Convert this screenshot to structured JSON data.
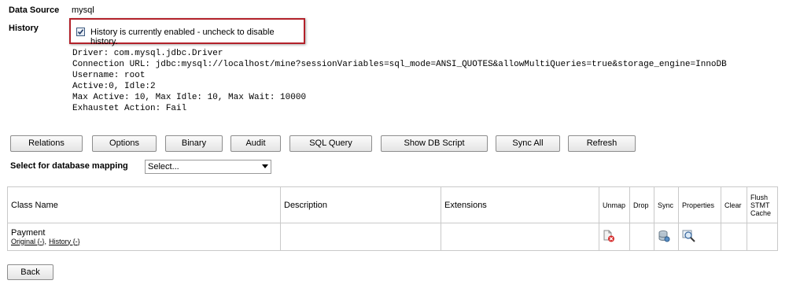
{
  "datasource": {
    "label": "Data Source",
    "value": "mysql"
  },
  "history": {
    "label": "History",
    "checkbox_text": "History is currently enabled - uncheck to disable history.",
    "checked": true
  },
  "connection_info": [
    "Driver: com.mysql.jdbc.Driver",
    "Connection URL: jdbc:mysql://localhost/mine?sessionVariables=sql_mode=ANSI_QUOTES&allowMultiQueries=true&storage_engine=InnoDB",
    "Username: root",
    "Active:0, Idle:2",
    "Max Active: 10, Max Idle: 10, Max Wait: 10000",
    "Exhaustet Action: Fail"
  ],
  "toolbar": {
    "relations": "Relations",
    "options": "Options",
    "binary": "Binary",
    "audit": "Audit",
    "sql_query": "SQL Query",
    "show_db_script": "Show DB Script",
    "sync_all": "Sync All",
    "refresh": "Refresh"
  },
  "mapping": {
    "label": "Select for database mapping",
    "selected": "Select..."
  },
  "table": {
    "headers": {
      "class_name": "Class Name",
      "description": "Description",
      "extensions": "Extensions",
      "unmap": "Unmap",
      "drop": "Drop",
      "sync": "Sync",
      "properties": "Properties",
      "clear": "Clear",
      "flush": [
        "Flush",
        "STMT",
        "Cache"
      ]
    },
    "rows": [
      {
        "class_name": "Payment",
        "links": {
          "original": "Original {-}",
          "separator": ",",
          "history": "History {-}"
        },
        "description": "",
        "extensions": ""
      }
    ]
  },
  "icons": {
    "unmap": "unmap-icon",
    "sync": "database-sync-icon",
    "properties": "magnifier-icon"
  },
  "back": "Back",
  "colors": {
    "highlight_border": "#b3212a"
  }
}
